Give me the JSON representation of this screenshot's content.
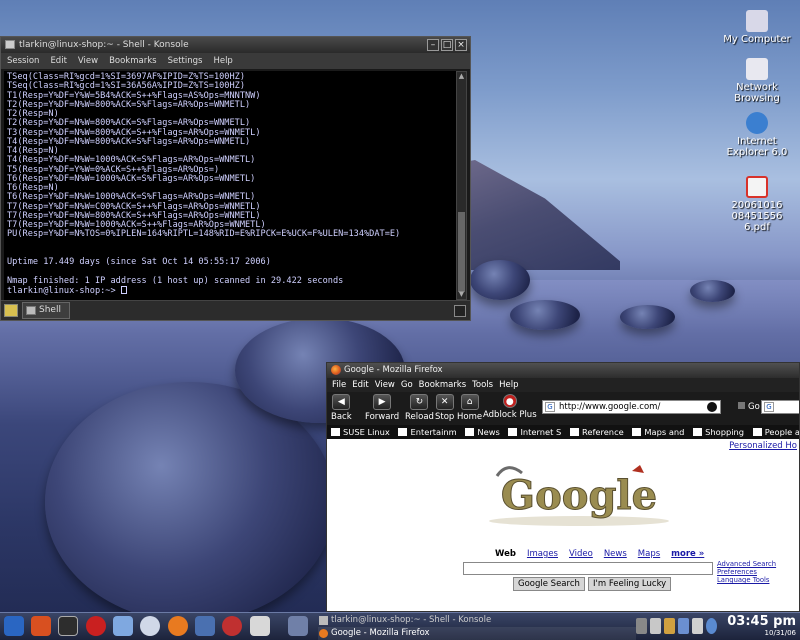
{
  "desktop": {
    "icons": [
      {
        "label": "My Computer",
        "icon": "computer-icon",
        "color": "#d8d8e8"
      },
      {
        "label": "Network Browsing",
        "icon": "network-icon",
        "color": "#e8e8f0"
      },
      {
        "label": "Internet Explorer 6.0",
        "icon": "ie-icon",
        "color": "#3b7fd0"
      },
      {
        "label": "20061016084515566.pdf",
        "icon": "pdf-icon",
        "color": "#d8322a"
      }
    ]
  },
  "konsole": {
    "title": "tlarkin@linux-shop:~ - Shell - Konsole",
    "menu": [
      "Session",
      "Edit",
      "View",
      "Bookmarks",
      "Settings",
      "Help"
    ],
    "output": "TSeq(Class=RI%gcd=1%SI=3697AF%IPID=Z%TS=100HZ)\nTSeq(Class=RI%gcd=1%SI=36A56A%IPID=Z%TS=100HZ)\nT1(Resp=Y%DF=Y%W=5B4%ACK=S++%Flags=AS%Ops=MNNTNW)\nT2(Resp=Y%DF=N%W=800%ACK=S%Flags=AR%Ops=WNMETL)\nT2(Resp=N)\nT2(Resp=Y%DF=N%W=800%ACK=S%Flags=AR%Ops=WNMETL)\nT3(Resp=Y%DF=N%W=800%ACK=S++%Flags=AR%Ops=WNMETL)\nT4(Resp=Y%DF=N%W=800%ACK=S%Flags=AR%Ops=WNMETL)\nT4(Resp=N)\nT4(Resp=Y%DF=N%W=1000%ACK=S%Flags=AR%Ops=WNMETL)\nT5(Resp=Y%DF=Y%W=0%ACK=S++%Flags=AR%Ops=)\nT6(Resp=Y%DF=N%W=1000%ACK=S%Flags=AR%Ops=WNMETL)\nT6(Resp=N)\nT6(Resp=Y%DF=N%W=1000%ACK=S%Flags=AR%Ops=WNMETL)\nT7(Resp=Y%DF=N%W=C00%ACK=S++%Flags=AR%Ops=WNMETL)\nT7(Resp=Y%DF=N%W=800%ACK=S++%Flags=AR%Ops=WNMETL)\nT7(Resp=Y%DF=N%W=1000%ACK=S++%Flags=AR%Ops=WNMETL)\nPU(Resp=Y%DF=N%TOS=0%IPLEN=164%RIPTL=148%RID=E%RIPCK=E%UCK=F%ULEN=134%DAT=E)\n\n\nUptime 17.449 days (since Sat Oct 14 05:55:17 2006)\n\nNmap finished: 1 IP address (1 host up) scanned in 29.422 seconds\ntlarkin@linux-shop:~> ",
    "tab_label": "Shell"
  },
  "firefox": {
    "title": "Google - Mozilla Firefox",
    "menu": [
      "File",
      "Edit",
      "View",
      "Go",
      "Bookmarks",
      "Tools",
      "Help"
    ],
    "nav": {
      "back": "Back",
      "forward": "Forward",
      "reload": "Reload",
      "stop": "Stop",
      "home": "Home",
      "adblock": "Adblock Plus",
      "go": "Go"
    },
    "url": "http://www.google.com/",
    "bookmarks": [
      "SUSE Linux",
      "Entertainm",
      "News",
      "Internet S",
      "Reference",
      "Maps and",
      "Shopping",
      "People an"
    ],
    "page": {
      "personalized": "Personalized Ho",
      "logo_text": "Google",
      "links": {
        "web": "Web",
        "images": "Images",
        "video": "Video",
        "news": "News",
        "maps": "Maps",
        "more": "more »"
      },
      "search_button": "Google Search",
      "lucky_button": "I'm Feeling Lucky",
      "advanced": [
        "Advanced Search",
        "Preferences",
        "Language Tools"
      ]
    }
  },
  "taskbar": {
    "tasks": [
      "tlarkin@linux-shop:~ - Shell - Konsole",
      "Google - Mozilla Firefox"
    ],
    "time": "03:45 pm",
    "date": "10/31/06"
  }
}
